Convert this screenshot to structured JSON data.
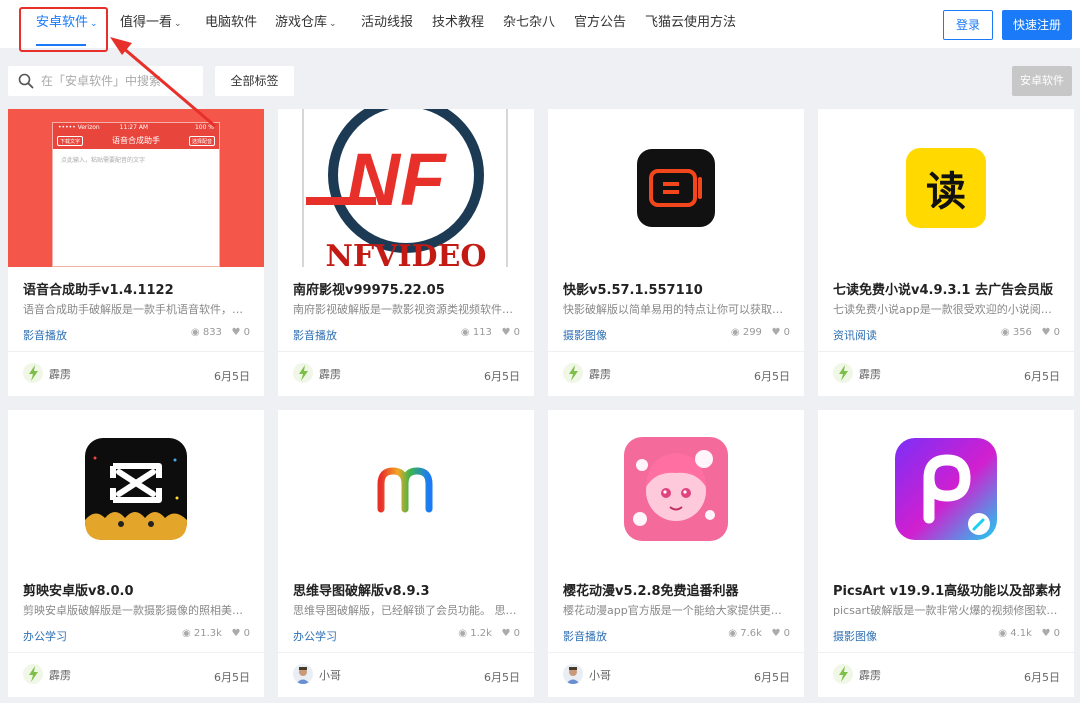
{
  "nav": {
    "items": [
      {
        "label": "安卓软件",
        "dropdown": true,
        "active": true
      },
      {
        "label": "值得一看",
        "dropdown": true
      },
      {
        "label": "电脑软件",
        "dropdown": false
      },
      {
        "label": "游戏仓库",
        "dropdown": true
      },
      {
        "label": "活动线报",
        "dropdown": false
      },
      {
        "label": "技术教程",
        "dropdown": false
      },
      {
        "label": "杂七杂八",
        "dropdown": false
      },
      {
        "label": "官方公告",
        "dropdown": false
      },
      {
        "label": "飞猫云使用方法",
        "dropdown": false
      }
    ],
    "login": "登录",
    "register": "快速注册"
  },
  "search": {
    "placeholder": "在「安卓软件」中搜索"
  },
  "all_tags": "全部标签",
  "category_button": "安卓软件",
  "icons": {
    "search": "search-icon",
    "views": "eye-icon",
    "likes": "heart-icon",
    "chevron": "chevron-down-icon"
  },
  "colors": {
    "accent": "#1a7af8",
    "highlight": "#e8302a",
    "category_link": "#2d6fb3"
  },
  "cards": [
    {
      "title": "语音合成助手v1.4.1122",
      "desc": "语音合成助手破解版是一款手机语音软件，能...",
      "category": "影音播放",
      "views": "833",
      "likes": "0",
      "author": "霹雳",
      "date": "6月5日",
      "thumb": {
        "carrier": "••••• Verizon",
        "time": "11:27 AM",
        "battery": "100 %",
        "header": "语音合成助手",
        "left_btn": "下载文字",
        "right_btn": "选择配音",
        "placeholder": "点此输入，粘贴需要配音的文字"
      }
    },
    {
      "title": "南府影视v99975.22.05",
      "desc": "南府影视破解版是一款影视资源类视频软件，...",
      "category": "影音播放",
      "views": "113",
      "likes": "0",
      "author": "霹雳",
      "date": "6月5日",
      "thumb": {
        "logo": "NF",
        "brand": "NFVIDEO"
      }
    },
    {
      "title": "快影v5.57.1.557110",
      "desc": "快影破解版以简单易用的特点让你可以获取到...",
      "category": "摄影图像",
      "views": "299",
      "likes": "0",
      "author": "霹雳",
      "date": "6月5日"
    },
    {
      "title": "七读免费小说v4.9.3.1 去广告会员版",
      "desc": "七读免费小说app是一款很受欢迎的小说阅读...",
      "category": "资讯阅读",
      "views": "356",
      "likes": "0",
      "author": "霹雳",
      "date": "6月5日",
      "thumb": {
        "glyph": "读"
      }
    },
    {
      "title": "剪映安卓版v8.0.0",
      "desc": "剪映安卓版破解版是一款摄影摄像的照相美颜...",
      "category": "办公学习",
      "views": "21.3k",
      "likes": "0",
      "author": "霹雳",
      "date": "6月5日"
    },
    {
      "title": "思维导图破解版v8.9.3",
      "desc": "思维导图破解版，已经解锁了会员功能。 思维...",
      "category": "办公学习",
      "views": "1.2k",
      "likes": "0",
      "author": "小哥",
      "date": "6月5日",
      "thumb": {
        "glyph": "m"
      }
    },
    {
      "title": "樱花动漫v5.2.8免费追番利器",
      "desc": "樱花动漫app官方版是一个能给大家提供更全...",
      "category": "影音播放",
      "views": "7.6k",
      "likes": "0",
      "author": "小哥",
      "date": "6月5日"
    },
    {
      "title": "PicsArt v19.9.1高级功能以及部素材",
      "desc": "picsart破解版是一款非常火爆的视频修图软件...",
      "category": "摄影图像",
      "views": "4.1k",
      "likes": "0",
      "author": "霹雳",
      "date": "6月5日"
    }
  ]
}
